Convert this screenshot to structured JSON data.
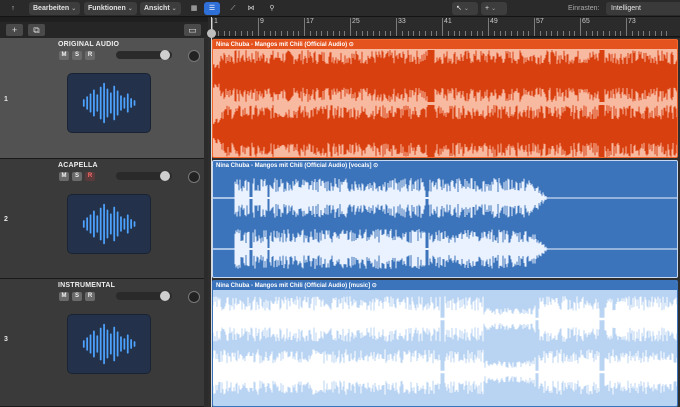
{
  "toolbar": {
    "edit": "Bearbeiten",
    "functions": "Funktionen",
    "view": "Ansicht",
    "snap_label": "Einrasten:",
    "snap_value": "Intelligent"
  },
  "ruler": {
    "bars": [
      "1",
      "9",
      "17",
      "25",
      "33",
      "41",
      "49",
      "57",
      "65",
      "73"
    ]
  },
  "tracks": [
    {
      "number": "1",
      "name": "ORIGINAL AUDIO",
      "region_title": "Nina Chuba - Mangos mit Chili (Official Audio)",
      "volume": 0.85,
      "color": "#e4521d"
    },
    {
      "number": "2",
      "name": "ACAPELLA",
      "region_title": "Nina Chuba - Mangos mit Chili (Official Audio) [vocals]",
      "volume": 0.85,
      "color": "#3c74bb"
    },
    {
      "number": "3",
      "name": "INSTRUMENTAL",
      "region_title": "Nina Chuba - Mangos mit Chili (Official Audio) [music]",
      "volume": 0.85,
      "color": "#3c74bb"
    }
  ],
  "buttons": {
    "mute": "M",
    "solo": "S",
    "record": "R"
  },
  "icons": {
    "add": "plus-icon",
    "duplicate": "duplicate-track-icon",
    "library": "library-icon",
    "grid_view": "grid-icon",
    "list_view": "list-icon",
    "automation": "automation-icon",
    "flex": "flex-icon",
    "tuner": "tuner-icon",
    "pointer": "pointer-tool-icon",
    "crosshair": "marquee-tool-icon",
    "region_loop": "loop-icon"
  }
}
